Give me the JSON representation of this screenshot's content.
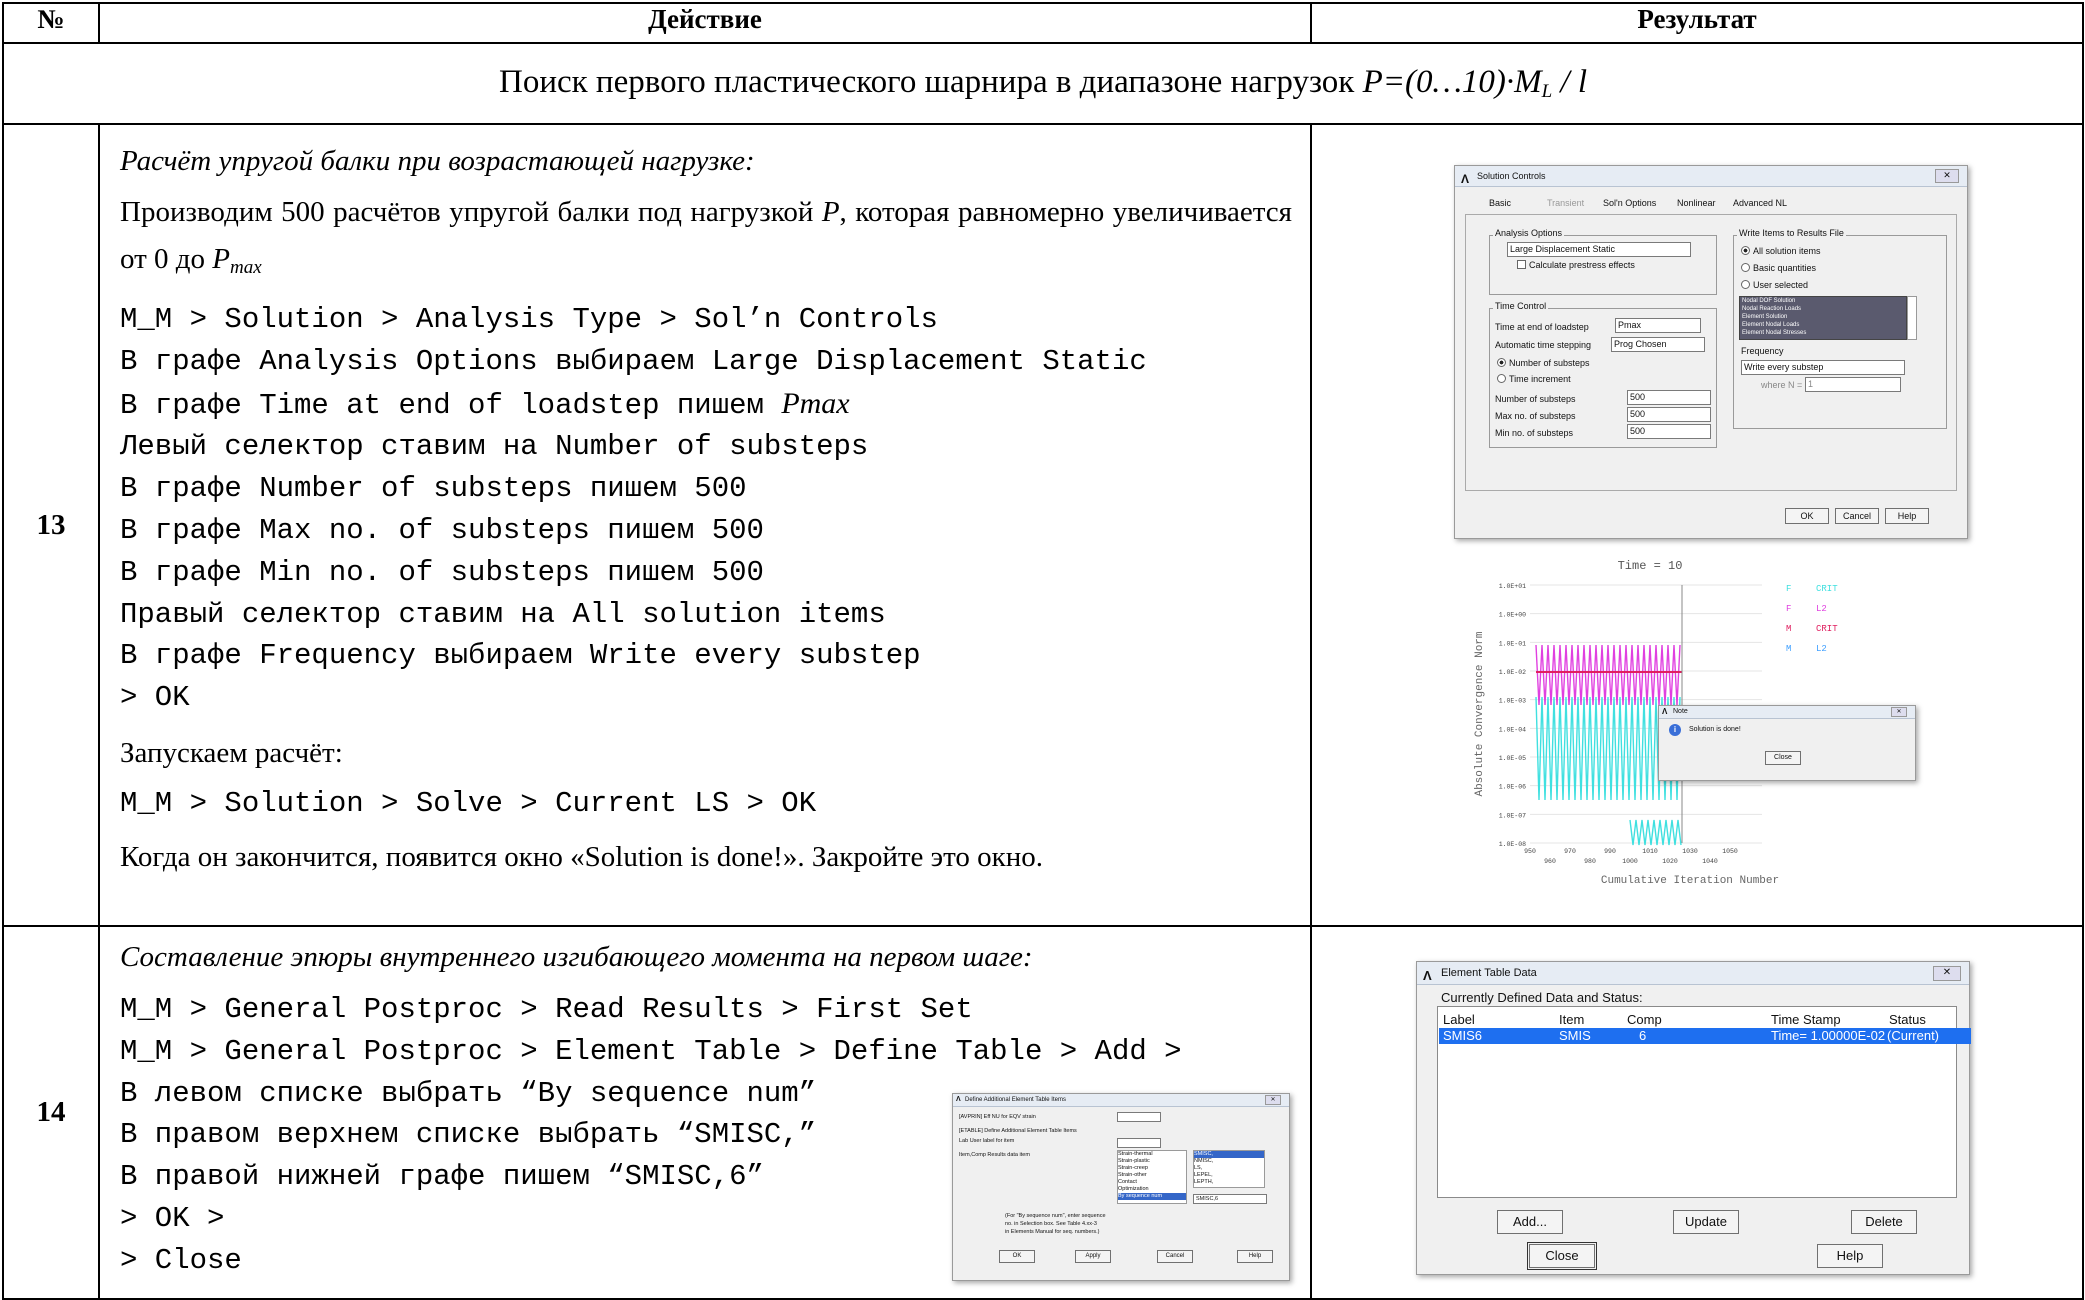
{
  "headers": {
    "num": "№",
    "action": "Действие",
    "result": "Результат"
  },
  "section": {
    "text": "Поиск первого пластического шарнира в диапазоне нагрузок ",
    "formula_p": "P=(0…10)·M",
    "formula_sub": "L",
    "formula_end": " / l"
  },
  "row13": {
    "num": "13",
    "title": "Расчёт упругой балки при возрастающей нагрузке:",
    "para_a": "Производим 500 расчётов упругой балки под нагрузкой ",
    "para_p": "P",
    "para_b": ", которая равномерно увеличивается от 0 до ",
    "para_pmax": "P",
    "para_pmax_sub": "max",
    "steps": [
      "M_M > Solution > Analysis Type > Sol’n Controls",
      "В графе Analysis Options выбираем Large Displacement Static",
      "В графе Time at end of loadstep пишем ",
      "Левый селектор ставим на Number of substeps",
      "В графе Number of substeps пишем 500",
      "В графе Max no. of substeps пишем 500",
      "В графе Min no. of substeps пишем 500",
      "Правый селектор ставим на All solution items",
      "В графе Frequency выбираем Write every substep",
      "> OK"
    ],
    "pmax_word": "Pmax",
    "run_label": "Запускаем расчёт:",
    "solve_path": "M_M > Solution > Solve > Current LS > OK",
    "finish": "Когда он закончится, появится окно «Solution is done!».  Закройте это окно."
  },
  "row14": {
    "num": "14",
    "title": "Составление эпюры внутреннего изгибающего момента на первом шаге:",
    "steps": [
      "M_M > General Postproc > Read Results > First Set",
      "M_M > General Postproc > Element Table > Define Table > Add >",
      "В левом списке выбрать “By sequence num”",
      "В правом верхнем списке выбрать “SMISC,”",
      "В правой нижней графе пишем “SMISC,6”",
      "> OK >",
      "> Close"
    ]
  },
  "solution_controls": {
    "title": "Solution Controls",
    "tabs": [
      "Basic",
      "Transient",
      "Sol'n Options",
      "Nonlinear",
      "Advanced NL"
    ],
    "analysis_options_label": "Analysis Options",
    "analysis_value": "Large Displacement Static",
    "prestress": "Calculate prestress effects",
    "time_control_label": "Time Control",
    "time_end_label": "Time at end of loadstep",
    "time_end_value": "Pmax",
    "auto_step_label": "Automatic time stepping",
    "auto_step_value": "Prog Chosen",
    "radio_substeps": "Number of substeps",
    "radio_increment": "Time increment",
    "num_substeps_label": "Number of substeps",
    "num_substeps": "500",
    "max_substeps_label": "Max no. of substeps",
    "max_substeps": "500",
    "min_substeps_label": "Min no. of substeps",
    "min_substeps": "500",
    "write_items_label": "Write Items to Results File",
    "radio_all": "All solution items",
    "radio_basic": "Basic quantities",
    "radio_user": "User selected",
    "list_items": [
      "Nodal DOF Solution",
      "Nodal Reaction Loads",
      "Element Solution",
      "Element Nodal Loads",
      "Element Nodal Stresses"
    ],
    "frequency_label": "Frequency",
    "frequency_value": "Write every substep",
    "where_n": "where N =",
    "n_value": "1",
    "ok": "OK",
    "cancel": "Cancel",
    "help": "Help"
  },
  "convergence": {
    "time_label": "Time = 10",
    "ylabel": "Absolute Convergence Norm",
    "xlabel": "Cumulative Iteration Number",
    "yticks": [
      "1.0E+01",
      "1.0E+00",
      "1.0E-01",
      "1.0E-02",
      "1.0E-03",
      "1.0E-04",
      "1.0E-05",
      "1.0E-06",
      "1.0E-07",
      "1.0E-08"
    ],
    "xticks_top": [
      "950",
      "970",
      "990",
      "1010",
      "1030",
      "1050"
    ],
    "xticks_bottom": [
      "960",
      "980",
      "1000",
      "1020",
      "1040"
    ],
    "legend": [
      [
        "F",
        "CRIT"
      ],
      [
        "F",
        "L2"
      ],
      [
        "M",
        "CRIT"
      ],
      [
        "M",
        "L2"
      ]
    ],
    "legend_colors": [
      "#40e0e0",
      "#e040e0",
      "#e02060",
      "#40a0ff"
    ],
    "note_title": "Note",
    "note_text": "Solution is done!",
    "note_close": "Close"
  },
  "chart_data": {
    "type": "line",
    "title": "Time = 10",
    "xlabel": "Cumulative Iteration Number",
    "ylabel": "Absolute Convergence Norm",
    "xlim": [
      940,
      1060
    ],
    "ylim": [
      1e-08,
      10
    ],
    "yscale": "log",
    "series": [
      {
        "name": "F CRIT",
        "color": "#40e0e0",
        "values": []
      },
      {
        "name": "F L2",
        "color": "#e040e0",
        "values": []
      },
      {
        "name": "M CRIT",
        "color": "#e02060",
        "values": []
      },
      {
        "name": "M L2",
        "color": "#40a0ff",
        "values": []
      }
    ]
  },
  "define_table": {
    "title": "Define Additional Element Table Items",
    "line1": "[AVPRIN]  Eff NU for EQV strain",
    "line2": "[ETABLE]  Define Additional Element Table Items",
    "lab": "Lab     User label for item",
    "item_comp": "Item,Comp  Results data item",
    "left_list": [
      "Strain-thermal",
      "Strain-plastic",
      "Strain-creep",
      "Strain-other",
      "Contact",
      "Optimization",
      "By sequence num"
    ],
    "right_list": [
      "SMISC,",
      "NMISC,",
      "LS,",
      "LEPEL,",
      "LEPTH,"
    ],
    "comp_value": "SMISC,6",
    "note": [
      "(For \"By sequence num\", enter sequence",
      "no. in Selection box.  See Table 4.xx-3",
      "in Elements Manual for seq. numbers.)"
    ],
    "ok": "OK",
    "apply": "Apply",
    "cancel": "Cancel",
    "help": "Help"
  },
  "element_table": {
    "title": "Element Table Data",
    "status_label": "Currently Defined Data and Status:",
    "columns": [
      "Label",
      "Item",
      "Comp",
      "Time Stamp",
      "Status"
    ],
    "row": [
      "SMIS6",
      "SMIS",
      "6",
      "Time= 1.00000E-02",
      "(Current)"
    ],
    "add": "Add...",
    "update": "Update",
    "delete": "Delete",
    "close": "Close",
    "help": "Help"
  }
}
